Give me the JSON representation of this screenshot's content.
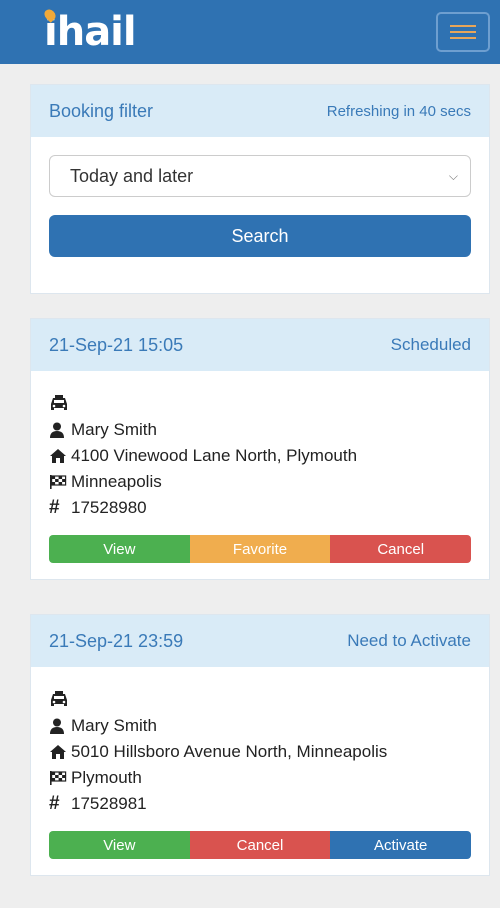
{
  "header": {
    "logo_text": "ihail",
    "menu_icon": "hamburger-menu-icon"
  },
  "filter": {
    "title": "Booking filter",
    "refresh": "Refreshing in 40 secs",
    "select_value": "Today and later",
    "search_label": "Search"
  },
  "bookings": [
    {
      "datetime": "21-Sep-21 15:05",
      "status": "Scheduled",
      "name": "Mary Smith",
      "pickup": "4100 Vinewood Lane North, Plymouth",
      "destination": "Minneapolis",
      "number": "17528980",
      "actions": [
        "View",
        "Favorite",
        "Cancel"
      ]
    },
    {
      "datetime": "21-Sep-21 23:59",
      "status": "Need to Activate",
      "name": "Mary Smith",
      "pickup": "5010 Hillsboro Avenue North, Minneapolis",
      "destination": "Plymouth",
      "number": "17528981",
      "actions": [
        "View",
        "Cancel",
        "Activate"
      ]
    }
  ],
  "colors": {
    "brand": "#2f72b2",
    "panel_header": "#d9ebf7",
    "view": "#4cb050",
    "favorite": "#f0ad4e",
    "cancel": "#d9534f",
    "activate": "#2f72b2"
  }
}
